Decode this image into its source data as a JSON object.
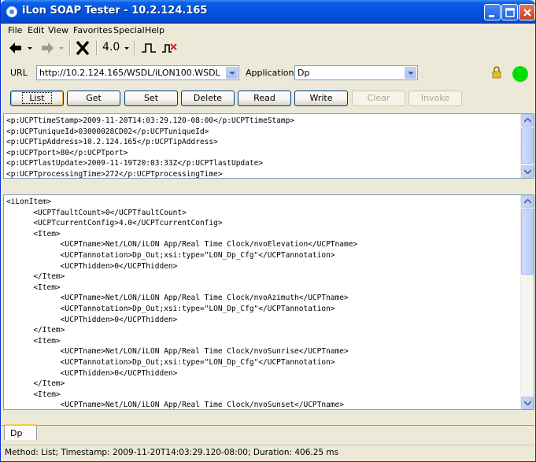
{
  "window": {
    "title": "iLon SOAP Tester - 10.2.124.165"
  },
  "menu": [
    "File",
    "Edit",
    "View",
    "Favorites",
    "Special",
    "Help"
  ],
  "toolbar": {
    "version_label": "4.0"
  },
  "url_row": {
    "url_label": "URL",
    "url_value": "http://10.2.124.165/WSDL/iLON100.WSDL",
    "application_label": "Application",
    "application_value": "Dp"
  },
  "buttons": {
    "list": "List",
    "get": "Get",
    "set": "Set",
    "delete": "Delete",
    "read": "Read",
    "write": "Write",
    "clear": "Clear",
    "invoke": "Invoke"
  },
  "header_pane": {
    "lines": [
      "<p:UCPTtimeStamp>2009-11-20T14:03:29.120-08:00</p:UCPTtimeStamp>",
      "<p:UCPTuniqueId>03000028CD02</p:UCPTuniqueId>",
      "<p:UCPTipAddress>10.2.124.165</p:UCPTipAddress>",
      "<p:UCPTport>80</p:UCPTport>",
      "<p:UCPTlastUpdate>2009-11-19T20:03:33Z</p:UCPTlastUpdate>",
      "<p:UCPTprocessingTime>272</p:UCPTprocessingTime>"
    ]
  },
  "body_pane": {
    "lines": [
      "<iLonItem>",
      "\t<UCPTfaultCount>0</UCPTfaultCount>",
      "\t<UCPTcurrentConfig>4.0</UCPTcurrentConfig>",
      "\t<Item>",
      "\t\t<UCPTname>Net/LON/iLON App/Real Time Clock/nvoElevation</UCPTname>",
      "\t\t<UCPTannotation>Dp_Out;xsi:type=\"LON_Dp_Cfg\"</UCPTannotation>",
      "\t\t<UCPThidden>0</UCPThidden>",
      "\t</Item>",
      "\t<Item>",
      "\t\t<UCPTname>Net/LON/iLON App/Real Time Clock/nvoAzimuth</UCPTname>",
      "\t\t<UCPTannotation>Dp_Out;xsi:type=\"LON_Dp_Cfg\"</UCPTannotation>",
      "\t\t<UCPThidden>0</UCPThidden>",
      "\t</Item>",
      "\t<Item>",
      "\t\t<UCPTname>Net/LON/iLON App/Real Time Clock/nvoSunrise</UCPTname>",
      "\t\t<UCPTannotation>Dp_Out;xsi:type=\"LON_Dp_Cfg\"</UCPTannotation>",
      "\t\t<UCPThidden>0</UCPThidden>",
      "\t</Item>",
      "\t<Item>",
      "\t\t<UCPTname>Net/LON/iLON App/Real Time Clock/nvoSunset</UCPTname>"
    ]
  },
  "tab": {
    "label": "Dp"
  },
  "status": {
    "text": "Method: List; Timestamp: 2009-11-20T14:03:29.120-08:00; Duration: 406.25 ms"
  },
  "colors": {
    "titlebar": "#0553dc",
    "connected_indicator": "#00e000",
    "lock": "#e8c020"
  },
  "icons": [
    "app-icon",
    "back-arrow-icon",
    "forward-arrow-icon",
    "stop-x-icon",
    "pulse-icon",
    "pulse-cancel-icon",
    "lock-icon",
    "status-indicator-icon"
  ]
}
